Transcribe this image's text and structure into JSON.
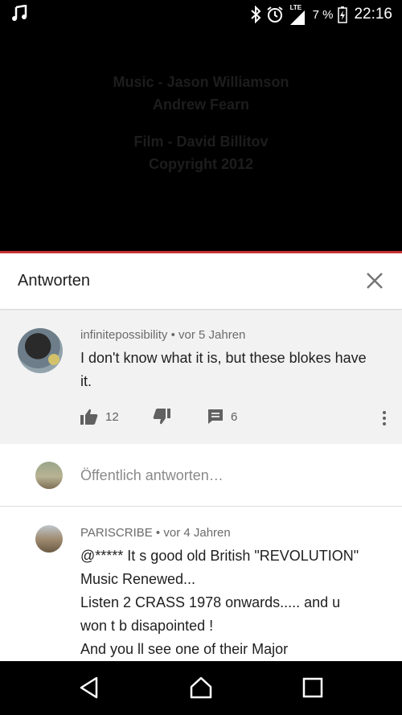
{
  "status_bar": {
    "network_label": "LTE",
    "battery_percent": "7 %",
    "time": "22:16",
    "icons": [
      "music-note-icon",
      "bluetooth-icon",
      "alarm-icon",
      "signal-icon",
      "battery-charging-icon"
    ]
  },
  "video": {
    "credits": [
      "Music - Jason Williamson",
      "Andrew Fearn",
      "Film - David Billitov",
      "Copyright 2012"
    ]
  },
  "panel": {
    "title": "Antworten",
    "close_icon": "close-icon"
  },
  "parent_comment": {
    "author": "infinitepossibility",
    "separator": "•",
    "age": "vor 5 Jahren",
    "text": "I don't know what it is, but these blokes have it.",
    "likes": "12",
    "replies": "6",
    "icons": [
      "thumbs-up-icon",
      "thumbs-down-icon",
      "reply-icon",
      "more-vert-icon"
    ]
  },
  "reply_input": {
    "placeholder": "Öffentlich antworten…"
  },
  "reply": {
    "author": "PARISCRIBE",
    "separator": "•",
    "age": "vor 4 Jahren",
    "lines": [
      "@***** It s good old British \"REVOLUTION\"",
      "Music Renewed...",
      "Listen 2 CRASS 1978 onwards..... and u",
      "won t b disapointed !",
      "And you ll see one of their Major"
    ]
  },
  "nav_bar": {
    "icons": [
      "back-icon",
      "home-icon",
      "recents-icon"
    ]
  },
  "colors": {
    "progress": "#c83232",
    "parent_bg": "#f2f2f2",
    "meta_text": "#6b6b6b"
  }
}
